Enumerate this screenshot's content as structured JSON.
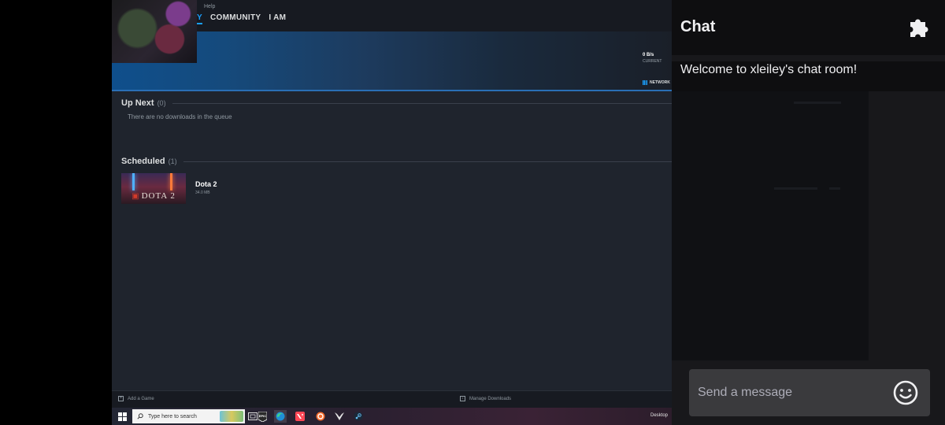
{
  "steam": {
    "menu_help": "Help",
    "nav": [
      {
        "label": "Y",
        "active": true
      },
      {
        "label": "COMMUNITY",
        "active": false
      },
      {
        "label": "I AM",
        "active": false
      }
    ],
    "speed_value": "0 B/s",
    "speed_label": "CURRENT",
    "network_label": "NETWORK",
    "up_next": {
      "title": "Up Next",
      "count": "(0)",
      "empty_text": "There are no downloads in the queue"
    },
    "scheduled": {
      "title": "Scheduled",
      "count": "(1)"
    },
    "downloads": [
      {
        "name": "Dota 2",
        "size": "34.0 MB",
        "thumb_text": "DOTA 2"
      }
    ],
    "bottom": {
      "add_game": "Add a Game",
      "manage_downloads": "Manage Downloads"
    }
  },
  "chat": {
    "title": "Chat",
    "welcome": "Welcome to xleiley's chat room!",
    "input_placeholder": "Send a message",
    "icons": {
      "extensions": "puzzle-icon",
      "emote": "smiley-icon"
    }
  },
  "taskbar": {
    "search_placeholder": "Type here to search",
    "desktop_label": "Desktop",
    "apps": [
      "task-view-icon",
      "epic-games-icon",
      "edge-icon",
      "valorant-icon",
      "origin-icon",
      "wolf-icon",
      "steam-icon"
    ]
  },
  "colors": {
    "steam_accent": "#1a9fff",
    "chat_bg": "#18181b",
    "chat_input": "#3a3a3d"
  }
}
